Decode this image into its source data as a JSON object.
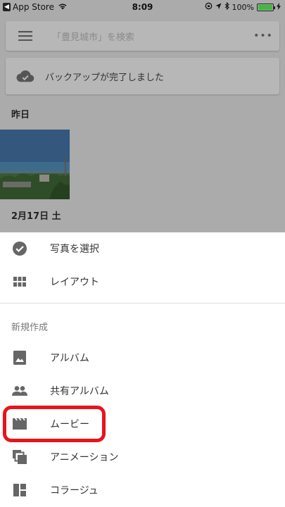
{
  "status_bar": {
    "back_badge": "◀",
    "carrier": "App Store",
    "time": "8:09",
    "battery_text": "100%",
    "battery_level": 1.0,
    "battery_color": "#3dbb3d"
  },
  "background": {
    "search_placeholder": "「豊見城市」を検索",
    "more_label": "•••",
    "backup_text": "バックアップが完了しました",
    "section_yesterday": "昨日",
    "section_date": "2月17日 土"
  },
  "sheet": {
    "items": [
      {
        "label": "写真を選択",
        "icon": "check-circle-icon"
      },
      {
        "label": "レイアウト",
        "icon": "grid-icon"
      }
    ],
    "create_header": "新規作成",
    "create_items": [
      {
        "label": "アルバム",
        "icon": "photo-album-icon"
      },
      {
        "label": "共有アルバム",
        "icon": "people-icon"
      },
      {
        "label": "ムービー",
        "icon": "movie-icon"
      },
      {
        "label": "アニメーション",
        "icon": "animation-icon"
      },
      {
        "label": "コラージュ",
        "icon": "collage-icon"
      }
    ]
  },
  "colors": {
    "dim_overlay": "#ababab",
    "highlight": "#e8141a",
    "icon_gray": "#666666"
  }
}
